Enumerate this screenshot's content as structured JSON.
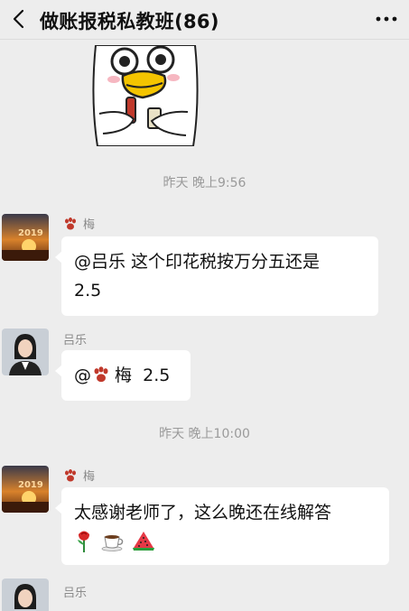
{
  "header": {
    "title": "做账报税私教班(86)",
    "back_icon": "chevron-left-icon",
    "more_icon": "more-dots-icon"
  },
  "messages": [
    {
      "type": "sticker",
      "icon": "duck-sticker"
    },
    {
      "type": "time",
      "text": "昨天 晚上9:56"
    },
    {
      "type": "text",
      "sender": "梅",
      "sender_icon": "paw-icon",
      "avatar": "sunset-2019-avatar",
      "line1": "@吕乐  这个印花税按万分五还是",
      "line2": "2.5"
    },
    {
      "type": "text",
      "sender": "吕乐",
      "avatar": "woman-portrait-avatar",
      "mention": "@",
      "mention_name": "梅",
      "mention_icon": "paw-icon",
      "text": "2.5"
    },
    {
      "type": "time",
      "text": "昨天 晚上10:00"
    },
    {
      "type": "text",
      "sender": "梅",
      "sender_icon": "paw-icon",
      "avatar": "sunset-2019-avatar",
      "line1": "太感谢老师了，这么晚还在线解答",
      "emojis": [
        "rose-emoji",
        "coffee-emoji",
        "watermelon-emoji"
      ]
    },
    {
      "type": "text",
      "sender": "吕乐",
      "avatar": "woman-portrait-avatar"
    }
  ],
  "colors": {
    "background": "#ededed",
    "bubble": "#ffffff",
    "timestamp": "#9a9a9a",
    "sender_name": "#8a8a8a",
    "paw": "#c0392b"
  }
}
